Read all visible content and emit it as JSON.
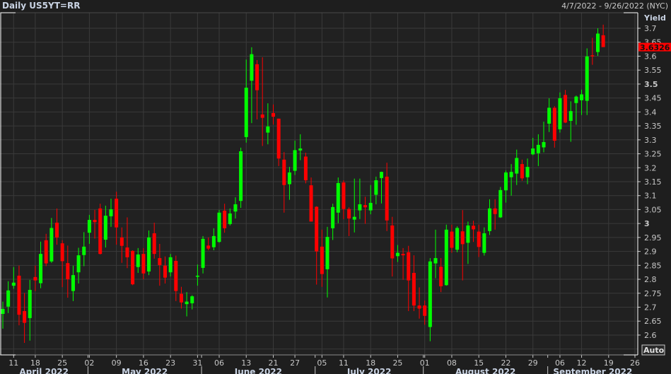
{
  "header": {
    "title": "Daily US5YT=RR",
    "date_range": "4/7/2022 - 9/26/2022 (NYC)"
  },
  "scale_button": "Auto",
  "colors": {
    "up": "#00ff00",
    "down": "#ff0000",
    "background": "#212121",
    "grid": "#3a3a3a",
    "text": "#c8c8c8",
    "last_price_box": "#ff0000"
  },
  "chart_data": {
    "type": "candlestick",
    "ylabel": "Yield",
    "ylim": [
      2.55,
      3.72
    ],
    "y_ticks": [
      "2.6",
      "2.65",
      "2.7",
      "2.75",
      "2.8",
      "2.85",
      "2.9",
      "2.95",
      "3",
      "3.05",
      "3.1",
      "3.15",
      "3.2",
      "3.25",
      "3.3",
      "3.35",
      "3.4",
      "3.45",
      "3.5",
      "3.55",
      "3.6",
      "3.65",
      "3.7"
    ],
    "y_ticks_bold": [
      "3",
      "3.5"
    ],
    "last_price": "3.6326",
    "grid": true,
    "fields": [
      "date",
      "open",
      "high",
      "low",
      "close"
    ],
    "candles": [
      [
        "2022-04-07",
        2.676,
        2.72,
        2.623,
        2.694
      ],
      [
        "2022-04-08",
        2.702,
        2.793,
        2.679,
        2.76
      ],
      [
        "2022-04-11",
        2.777,
        2.844,
        2.766,
        2.788
      ],
      [
        "2022-04-12",
        2.813,
        2.849,
        2.635,
        2.673
      ],
      [
        "2022-04-13",
        2.686,
        2.751,
        2.572,
        2.644
      ],
      [
        "2022-04-14",
        2.661,
        2.798,
        2.58,
        2.762
      ],
      [
        "2022-04-18",
        2.808,
        2.849,
        2.758,
        2.796
      ],
      [
        "2022-04-19",
        2.786,
        2.935,
        2.768,
        2.891
      ],
      [
        "2022-04-20",
        2.94,
        2.963,
        2.847,
        2.857
      ],
      [
        "2022-04-21",
        2.864,
        3.02,
        2.859,
        2.984
      ],
      [
        "2022-04-22",
        3.003,
        3.054,
        2.924,
        2.95
      ],
      [
        "2022-04-25",
        2.929,
        2.94,
        2.772,
        2.865
      ],
      [
        "2022-04-26",
        2.858,
        2.921,
        2.734,
        2.8
      ],
      [
        "2022-04-27",
        2.758,
        2.849,
        2.722,
        2.815
      ],
      [
        "2022-04-28",
        2.825,
        2.913,
        2.785,
        2.886
      ],
      [
        "2022-04-29",
        2.887,
        2.969,
        2.847,
        2.917
      ],
      [
        "2022-05-02",
        2.967,
        3.031,
        2.927,
        3.013
      ],
      [
        "2022-05-03",
        3.013,
        3.049,
        2.946,
        3.005
      ],
      [
        "2022-05-04",
        3.054,
        3.071,
        2.889,
        2.891
      ],
      [
        "2022-05-05",
        2.942,
        3.064,
        2.914,
        3.028
      ],
      [
        "2022-05-06",
        3.026,
        3.089,
        2.988,
        3.051
      ],
      [
        "2022-05-09",
        3.089,
        3.114,
        2.924,
        2.986
      ],
      [
        "2022-05-10",
        2.95,
        2.986,
        2.859,
        2.92
      ],
      [
        "2022-05-11",
        2.914,
        3.022,
        2.84,
        2.879
      ],
      [
        "2022-05-12",
        2.902,
        2.904,
        2.779,
        2.782
      ],
      [
        "2022-05-13",
        2.844,
        2.912,
        2.823,
        2.889
      ],
      [
        "2022-05-16",
        2.891,
        2.912,
        2.8,
        2.821
      ],
      [
        "2022-05-17",
        2.828,
        2.975,
        2.815,
        2.95
      ],
      [
        "2022-05-18",
        2.965,
        3.003,
        2.874,
        2.891
      ],
      [
        "2022-05-19",
        2.876,
        2.927,
        2.777,
        2.851
      ],
      [
        "2022-05-20",
        2.849,
        2.882,
        2.785,
        2.806
      ],
      [
        "2022-05-23",
        2.825,
        2.891,
        2.81,
        2.879
      ],
      [
        "2022-05-24",
        2.866,
        2.885,
        2.722,
        2.758
      ],
      [
        "2022-05-25",
        2.748,
        2.773,
        2.695,
        2.717
      ],
      [
        "2022-05-26",
        2.711,
        2.754,
        2.667,
        2.72
      ],
      [
        "2022-05-27",
        2.714,
        2.743,
        2.692,
        2.739
      ],
      [
        "2022-05-31",
        2.809,
        2.853,
        2.777,
        2.813
      ],
      [
        "2022-06-01",
        2.841,
        2.955,
        2.821,
        2.945
      ],
      [
        "2022-06-02",
        2.921,
        2.95,
        2.904,
        2.91
      ],
      [
        "2022-06-03",
        2.915,
        2.983,
        2.904,
        2.955
      ],
      [
        "2022-06-06",
        2.934,
        3.049,
        2.931,
        3.039
      ],
      [
        "2022-06-07",
        3.046,
        3.071,
        2.967,
        2.983
      ],
      [
        "2022-06-08",
        2.998,
        3.054,
        2.993,
        3.036
      ],
      [
        "2022-06-09",
        3.043,
        3.094,
        3.018,
        3.069
      ],
      [
        "2022-06-10",
        3.081,
        3.272,
        3.056,
        3.259
      ],
      [
        "2022-06-13",
        3.31,
        3.588,
        3.29,
        3.487
      ],
      [
        "2022-06-14",
        3.512,
        3.632,
        3.36,
        3.607
      ],
      [
        "2022-06-15",
        3.571,
        3.586,
        3.373,
        3.478
      ],
      [
        "2022-06-16",
        3.391,
        3.596,
        3.278,
        3.379
      ],
      [
        "2022-06-17",
        3.326,
        3.431,
        3.284,
        3.348
      ],
      [
        "2022-06-21",
        3.396,
        3.427,
        3.355,
        3.383
      ],
      [
        "2022-06-22",
        3.376,
        3.376,
        3.206,
        3.233
      ],
      [
        "2022-06-23",
        3.229,
        3.256,
        3.039,
        3.138
      ],
      [
        "2022-06-24",
        3.141,
        3.203,
        3.085,
        3.183
      ],
      [
        "2022-06-27",
        3.189,
        3.297,
        3.174,
        3.263
      ],
      [
        "2022-06-28",
        3.262,
        3.32,
        3.227,
        3.269
      ],
      [
        "2022-06-29",
        3.24,
        3.254,
        3.144,
        3.155
      ],
      [
        "2022-06-30",
        3.137,
        3.165,
        3.007,
        3.007
      ],
      [
        "2022-07-01",
        3.06,
        3.062,
        2.781,
        2.9
      ],
      [
        "2022-07-05",
        2.917,
        2.978,
        2.773,
        2.819
      ],
      [
        "2022-07-06",
        2.836,
        2.988,
        2.735,
        2.952
      ],
      [
        "2022-07-07",
        2.983,
        3.071,
        2.941,
        3.059
      ],
      [
        "2022-07-08",
        3.039,
        3.165,
        3.001,
        3.145
      ],
      [
        "2022-07-11",
        3.147,
        3.155,
        3.016,
        3.052
      ],
      [
        "2022-07-12",
        3.052,
        3.058,
        2.955,
        3.018
      ],
      [
        "2022-07-13",
        3.014,
        3.161,
        2.968,
        3.024
      ],
      [
        "2022-07-14",
        3.047,
        3.161,
        3.016,
        3.069
      ],
      [
        "2022-07-15",
        3.066,
        3.096,
        2.999,
        3.058
      ],
      [
        "2022-07-18",
        3.047,
        3.138,
        3.033,
        3.074
      ],
      [
        "2022-07-19",
        3.103,
        3.168,
        3.069,
        3.155
      ],
      [
        "2022-07-20",
        3.163,
        3.186,
        3.072,
        3.185
      ],
      [
        "2022-07-21",
        3.168,
        3.218,
        2.973,
        3.011
      ],
      [
        "2022-07-22",
        2.993,
        3.024,
        2.81,
        2.875
      ],
      [
        "2022-07-25",
        2.883,
        2.923,
        2.862,
        2.895
      ],
      [
        "2022-07-26",
        2.891,
        2.912,
        2.798,
        2.886
      ],
      [
        "2022-07-27",
        2.897,
        2.92,
        2.686,
        2.796
      ],
      [
        "2022-07-28",
        2.823,
        2.886,
        2.686,
        2.706
      ],
      [
        "2022-07-29",
        2.706,
        2.771,
        2.659,
        2.695
      ],
      [
        "2022-08-01",
        2.706,
        2.724,
        2.637,
        2.669
      ],
      [
        "2022-08-02",
        2.629,
        2.876,
        2.578,
        2.864
      ],
      [
        "2022-08-03",
        2.857,
        2.978,
        2.804,
        2.876
      ],
      [
        "2022-08-04",
        2.845,
        2.876,
        2.754,
        2.775
      ],
      [
        "2022-08-05",
        2.779,
        2.996,
        2.777,
        2.978
      ],
      [
        "2022-08-08",
        2.971,
        2.996,
        2.895,
        2.913
      ],
      [
        "2022-08-09",
        2.906,
        2.99,
        2.897,
        2.984
      ],
      [
        "2022-08-10",
        2.972,
        3.048,
        2.796,
        2.926
      ],
      [
        "2022-08-11",
        2.931,
        3.007,
        2.855,
        2.993
      ],
      [
        "2022-08-12",
        2.992,
        3.01,
        2.934,
        2.979
      ],
      [
        "2022-08-15",
        2.971,
        2.996,
        2.88,
        2.916
      ],
      [
        "2022-08-16",
        2.895,
        2.986,
        2.885,
        2.965
      ],
      [
        "2022-08-17",
        2.973,
        3.087,
        2.959,
        3.054
      ],
      [
        "2022-08-18",
        3.054,
        3.087,
        2.978,
        3.034
      ],
      [
        "2022-08-19",
        3.022,
        3.131,
        3.02,
        3.12
      ],
      [
        "2022-08-22",
        3.119,
        3.19,
        3.075,
        3.183
      ],
      [
        "2022-08-23",
        3.166,
        3.213,
        3.1,
        3.185
      ],
      [
        "2022-08-24",
        3.179,
        3.265,
        3.138,
        3.235
      ],
      [
        "2022-08-25",
        3.213,
        3.229,
        3.153,
        3.162
      ],
      [
        "2022-08-26",
        3.166,
        3.233,
        3.141,
        3.203
      ],
      [
        "2022-08-29",
        3.248,
        3.307,
        3.245,
        3.269
      ],
      [
        "2022-08-30",
        3.252,
        3.32,
        3.206,
        3.282
      ],
      [
        "2022-08-31",
        3.273,
        3.365,
        3.255,
        3.292
      ],
      [
        "2022-09-01",
        3.358,
        3.449,
        3.328,
        3.415
      ],
      [
        "2022-09-02",
        3.415,
        3.421,
        3.272,
        3.297
      ],
      [
        "2022-09-06",
        3.338,
        3.47,
        3.326,
        3.449
      ],
      [
        "2022-09-07",
        3.461,
        3.479,
        3.36,
        3.362
      ],
      [
        "2022-09-08",
        3.368,
        3.438,
        3.293,
        3.403
      ],
      [
        "2022-09-09",
        3.432,
        3.459,
        3.354,
        3.455
      ],
      [
        "2022-09-12",
        3.442,
        3.48,
        3.389,
        3.463
      ],
      [
        "2022-09-13",
        3.44,
        3.628,
        3.389,
        3.599
      ],
      [
        "2022-09-14",
        3.603,
        3.666,
        3.569,
        3.6
      ],
      [
        "2022-09-15",
        3.615,
        3.7,
        3.601,
        3.681
      ],
      [
        "2022-09-16",
        3.675,
        3.713,
        3.637,
        3.6326
      ]
    ],
    "x_ticks": [
      {
        "label": "11",
        "date": "2022-04-11"
      },
      {
        "label": "18",
        "date": "2022-04-18"
      },
      {
        "label": "25",
        "date": "2022-04-25"
      },
      {
        "label": "02",
        "date": "2022-05-02"
      },
      {
        "label": "09",
        "date": "2022-05-09"
      },
      {
        "label": "16",
        "date": "2022-05-16"
      },
      {
        "label": "23",
        "date": "2022-05-23"
      },
      {
        "label": "31",
        "date": "2022-05-31"
      },
      {
        "label": "06",
        "date": "2022-06-06"
      },
      {
        "label": "13",
        "date": "2022-06-13"
      },
      {
        "label": "21",
        "date": "2022-06-21"
      },
      {
        "label": "27",
        "date": "2022-06-27"
      },
      {
        "label": "05",
        "date": "2022-07-05"
      },
      {
        "label": "11",
        "date": "2022-07-11"
      },
      {
        "label": "18",
        "date": "2022-07-18"
      },
      {
        "label": "25",
        "date": "2022-07-25"
      },
      {
        "label": "01",
        "date": "2022-08-01"
      },
      {
        "label": "08",
        "date": "2022-08-08"
      },
      {
        "label": "15",
        "date": "2022-08-15"
      },
      {
        "label": "22",
        "date": "2022-08-22"
      },
      {
        "label": "29",
        "date": "2022-08-29"
      },
      {
        "label": "06",
        "date": "2022-09-06"
      },
      {
        "label": "12",
        "date": "2022-09-12"
      },
      {
        "label": "19",
        "date": "2022-09-19"
      },
      {
        "label": "26",
        "date": "2022-09-26"
      }
    ],
    "months": [
      {
        "label": "April 2022",
        "start": "2022-04-07"
      },
      {
        "label": "May 2022",
        "start": "2022-05-02"
      },
      {
        "label": "June 2022",
        "start": "2022-06-01"
      },
      {
        "label": "July 2022",
        "start": "2022-07-01"
      },
      {
        "label": "August 2022",
        "start": "2022-08-01"
      },
      {
        "label": "September 2022",
        "start": "2022-09-01"
      }
    ]
  }
}
